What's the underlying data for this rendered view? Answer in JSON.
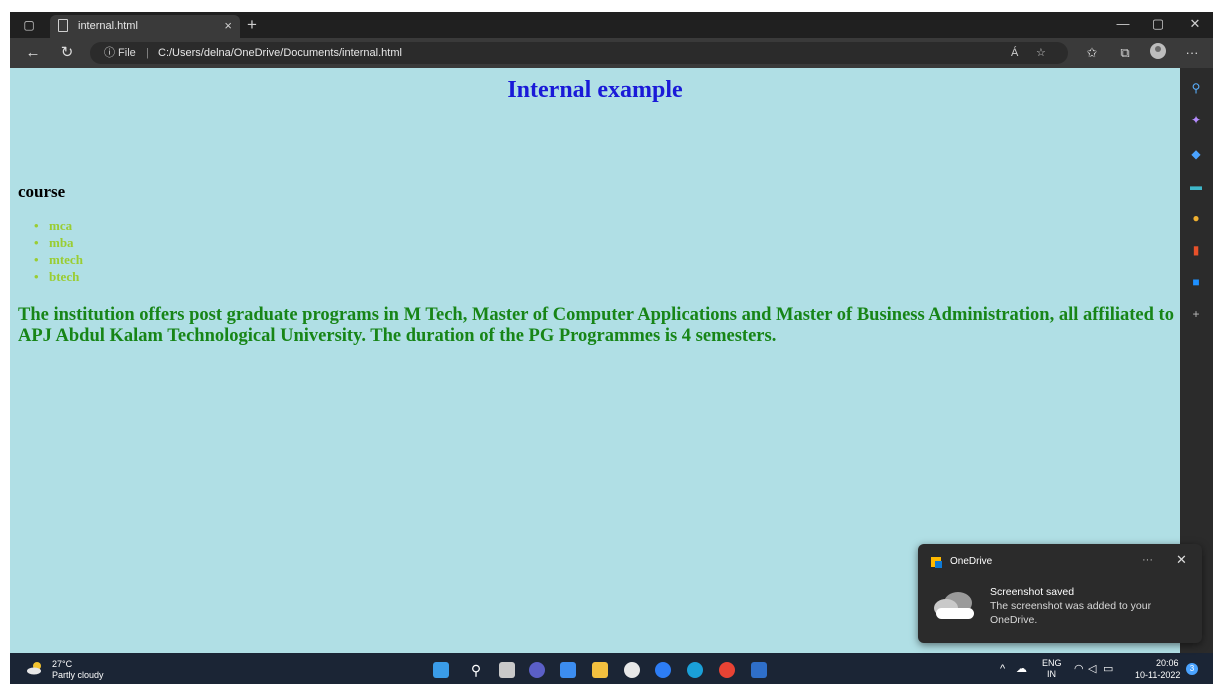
{
  "browser": {
    "tab_title": "internal.html",
    "tab_close": "×",
    "new_tab": "+",
    "info_label": "ⓘ File",
    "separator": "|",
    "url": "C:/Users/delna/OneDrive/Documents/internal.html",
    "read_aloud": "Á"
  },
  "page": {
    "heading": "Internal example",
    "subheading": "course",
    "courses": [
      "mca",
      "mba",
      "mtech",
      "btech"
    ],
    "paragraph": "The institution offers post graduate programs in M Tech, Master of Computer Applications and Master of Business Administration, all affiliated to APJ Abdul Kalam Technological University. The duration of the PG Programmes is 4 semesters."
  },
  "toast": {
    "app_name": "OneDrive",
    "more": "···",
    "close": "✕",
    "title": "Screenshot saved",
    "body": "The screenshot was added to your OneDrive."
  },
  "taskbar": {
    "temperature": "27°C",
    "condition": "Partly cloudy",
    "lang_top": "ENG",
    "lang_bottom": "IN",
    "time": "20:06",
    "date": "10-11-2022",
    "notifications": "3"
  },
  "colors": {
    "page_bg": "#b0dfe5",
    "heading": "#1a1ad8",
    "list_items": "#9acd32",
    "paragraph": "#178517"
  }
}
